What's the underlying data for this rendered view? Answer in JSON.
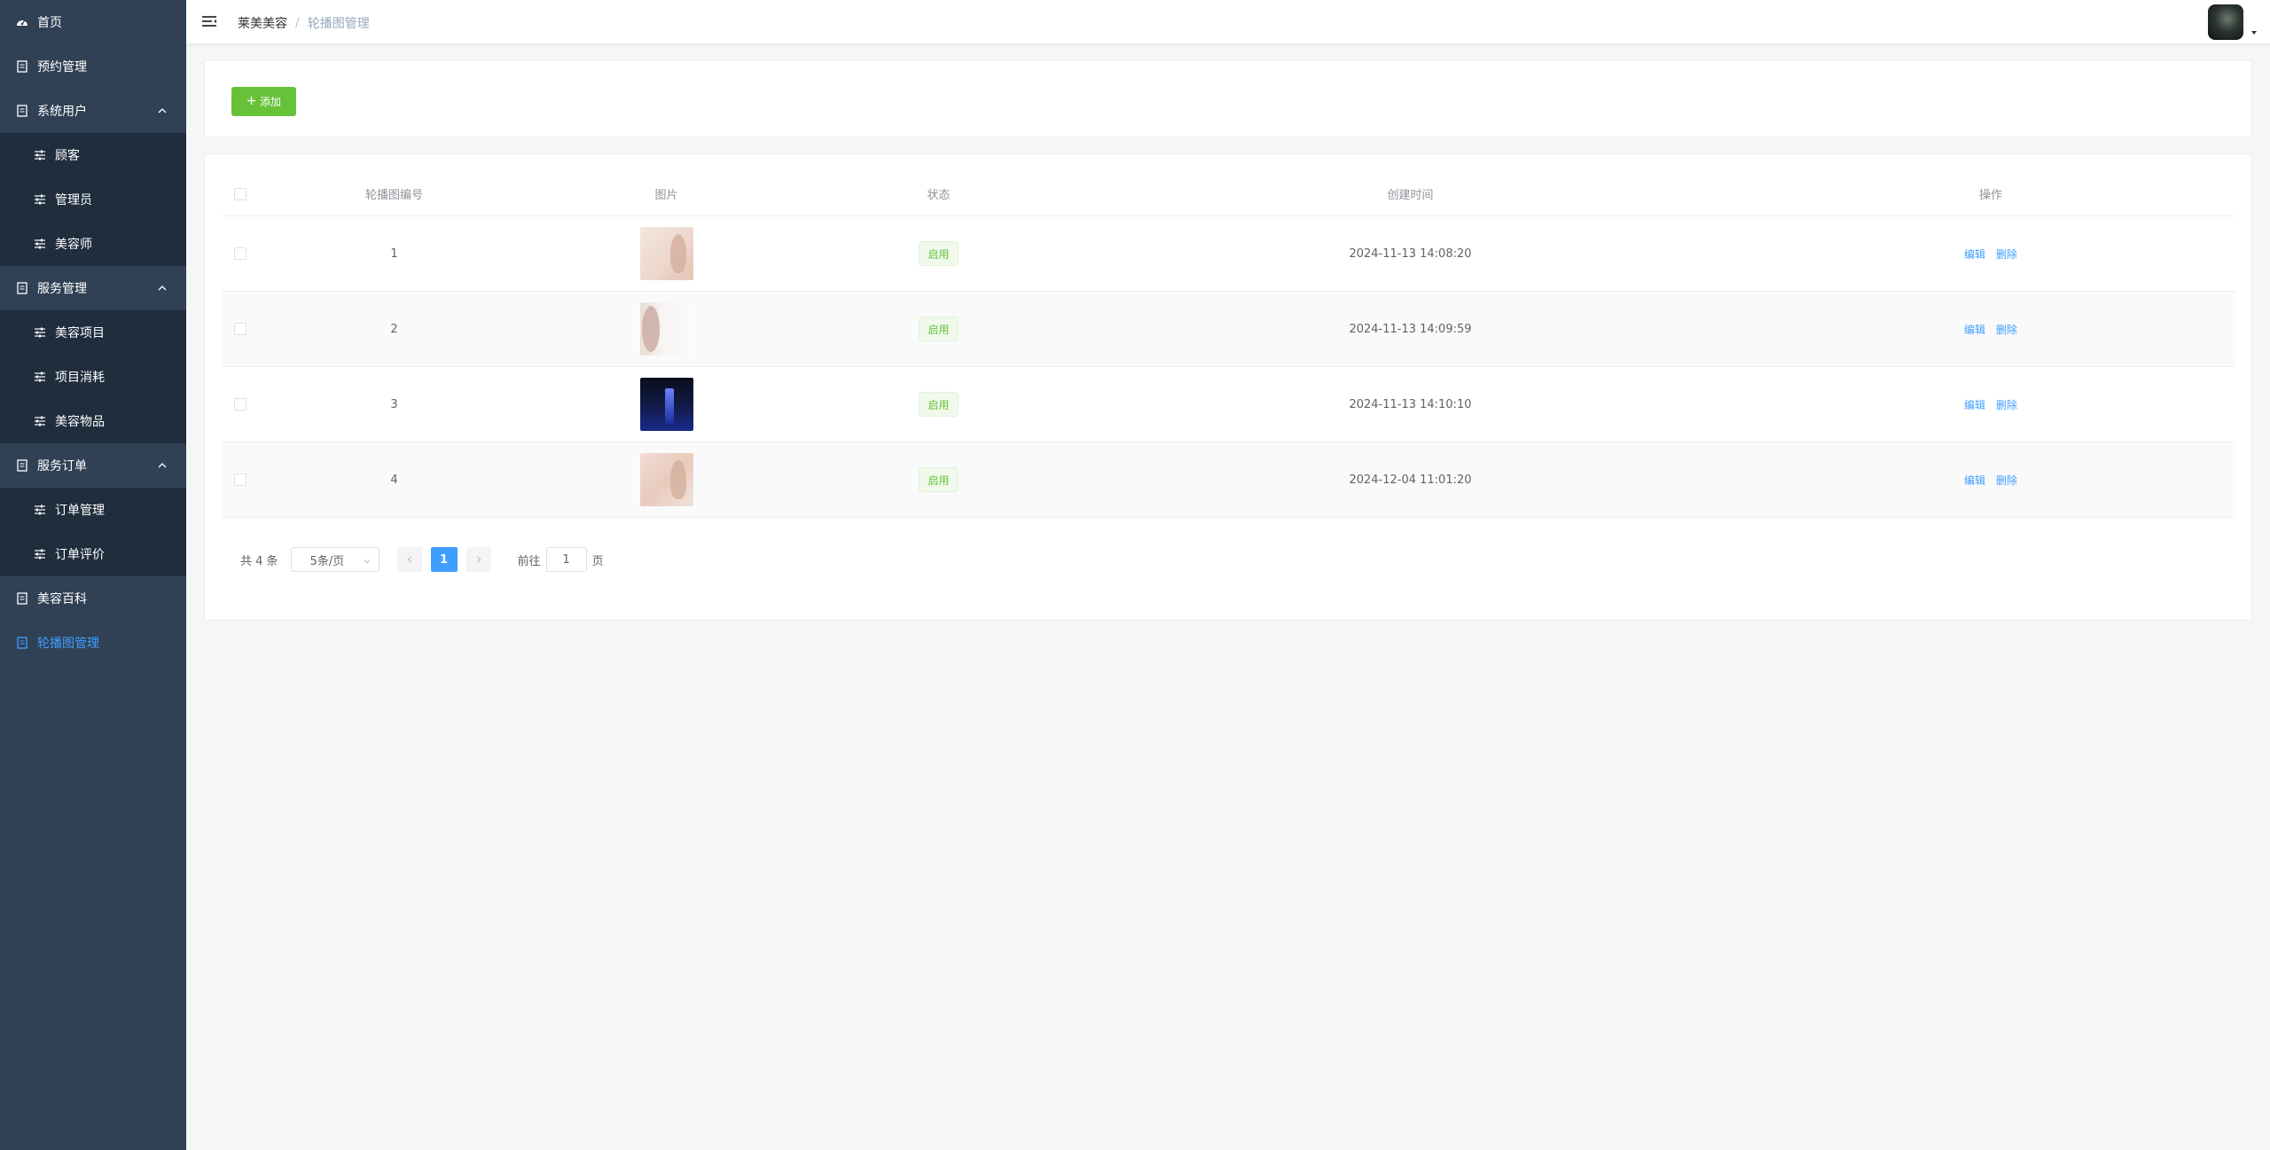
{
  "sidebar": {
    "items": [
      {
        "label": "首页",
        "icon": "dashboard-icon"
      },
      {
        "label": "预约管理",
        "icon": "document-icon"
      },
      {
        "label": "系统用户",
        "icon": "document-icon",
        "expanded": true
      },
      {
        "label": "顾客",
        "icon": "sliders-icon"
      },
      {
        "label": "管理员",
        "icon": "sliders-icon"
      },
      {
        "label": "美容师",
        "icon": "sliders-icon"
      },
      {
        "label": "服务管理",
        "icon": "document-icon",
        "expanded": true
      },
      {
        "label": "美容项目",
        "icon": "sliders-icon"
      },
      {
        "label": "项目消耗",
        "icon": "sliders-icon"
      },
      {
        "label": "美容物品",
        "icon": "sliders-icon"
      },
      {
        "label": "服务订单",
        "icon": "document-icon",
        "expanded": true
      },
      {
        "label": "订单管理",
        "icon": "sliders-icon"
      },
      {
        "label": "订单评价",
        "icon": "sliders-icon"
      },
      {
        "label": "美容百科",
        "icon": "document-icon"
      },
      {
        "label": "轮播图管理",
        "icon": "document-icon",
        "active": true
      }
    ]
  },
  "header": {
    "breadcrumb": [
      "莱美美容",
      "轮播图管理"
    ],
    "separator": "/"
  },
  "toolbar": {
    "add_label": "添加",
    "add_icon": "plus-icon"
  },
  "table": {
    "columns": [
      "轮播图编号",
      "图片",
      "状态",
      "创建时间",
      "操作"
    ],
    "rows": [
      {
        "id": "1",
        "status": "启用",
        "created": "2024-11-13 14:08:20"
      },
      {
        "id": "2",
        "status": "启用",
        "created": "2024-11-13 14:09:59"
      },
      {
        "id": "3",
        "status": "启用",
        "created": "2024-11-13 14:10:10"
      },
      {
        "id": "4",
        "status": "启用",
        "created": "2024-12-04 11:01:20"
      }
    ],
    "edit_label": "编辑",
    "delete_label": "删除"
  },
  "pagination": {
    "total_text": "共 4 条",
    "page_size": "5条/页",
    "current_page": "1",
    "goto_prefix": "前往",
    "goto_value": "1",
    "goto_suffix": "页"
  },
  "colors": {
    "sidebar_bg": "#304156",
    "submenu_bg": "#1f2d3d",
    "active": "#409eff",
    "success": "#67c23a"
  }
}
